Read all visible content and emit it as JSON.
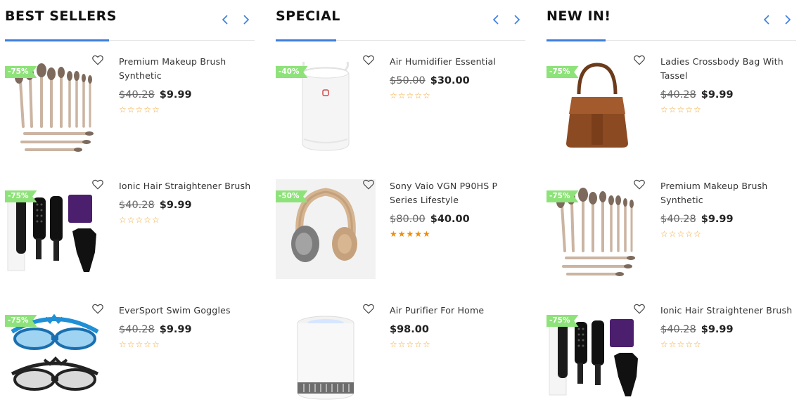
{
  "columns": [
    {
      "title": "BEST SELLERS",
      "products": [
        {
          "name": "Premium Makeup Brush Synthetic",
          "old_price": "$40.28",
          "price": "$9.99",
          "discount": "-75%",
          "rating": "☆☆☆☆☆",
          "image": "makeup-brushes"
        },
        {
          "name": "Ionic Hair Straightener Brush",
          "old_price": "$40.28",
          "price": "$9.99",
          "discount": "-75%",
          "rating": "☆☆☆☆☆",
          "image": "hair-straightener"
        },
        {
          "name": "EverSport Swim Goggles",
          "old_price": "$40.28",
          "price": "$9.99",
          "discount": "-75%",
          "rating": "☆☆☆☆☆",
          "image": "swim-goggles"
        }
      ]
    },
    {
      "title": "SPECIAL",
      "products": [
        {
          "name": "Air Humidifier Essential",
          "old_price": "$50.00",
          "price": "$30.00",
          "discount": "-40%",
          "rating": "☆☆☆☆☆",
          "image": "humidifier"
        },
        {
          "name": "Sony Vaio VGN P90HS P Series Lifestyle",
          "old_price": "$80.00",
          "price": "$40.00",
          "discount": "-50%",
          "rating": "★★★★★",
          "image": "headphones"
        },
        {
          "name": "Air Purifier For Home",
          "old_price": "",
          "price": "$98.00",
          "discount": "",
          "rating": "☆☆☆☆☆",
          "image": "air-purifier"
        }
      ]
    },
    {
      "title": "NEW IN!",
      "products": [
        {
          "name": "Ladies Crossbody Bag With Tassel",
          "old_price": "$40.28",
          "price": "$9.99",
          "discount": "-75%",
          "rating": "☆☆☆☆☆",
          "image": "handbag"
        },
        {
          "name": "Premium Makeup Brush Synthetic",
          "old_price": "$40.28",
          "price": "$9.99",
          "discount": "-75%",
          "rating": "☆☆☆☆☆",
          "image": "makeup-brushes"
        },
        {
          "name": "Ionic Hair Straightener Brush",
          "old_price": "$40.28",
          "price": "$9.99",
          "discount": "-75%",
          "rating": "☆☆☆☆☆",
          "image": "hair-straightener"
        }
      ]
    }
  ],
  "colors": {
    "accent": "#3b7de0",
    "discount_badge": "#8ee27a",
    "star": "#f3a32a"
  },
  "icons": {
    "prev": "chevron-left-icon",
    "next": "chevron-right-icon",
    "wishlist": "heart-icon"
  }
}
